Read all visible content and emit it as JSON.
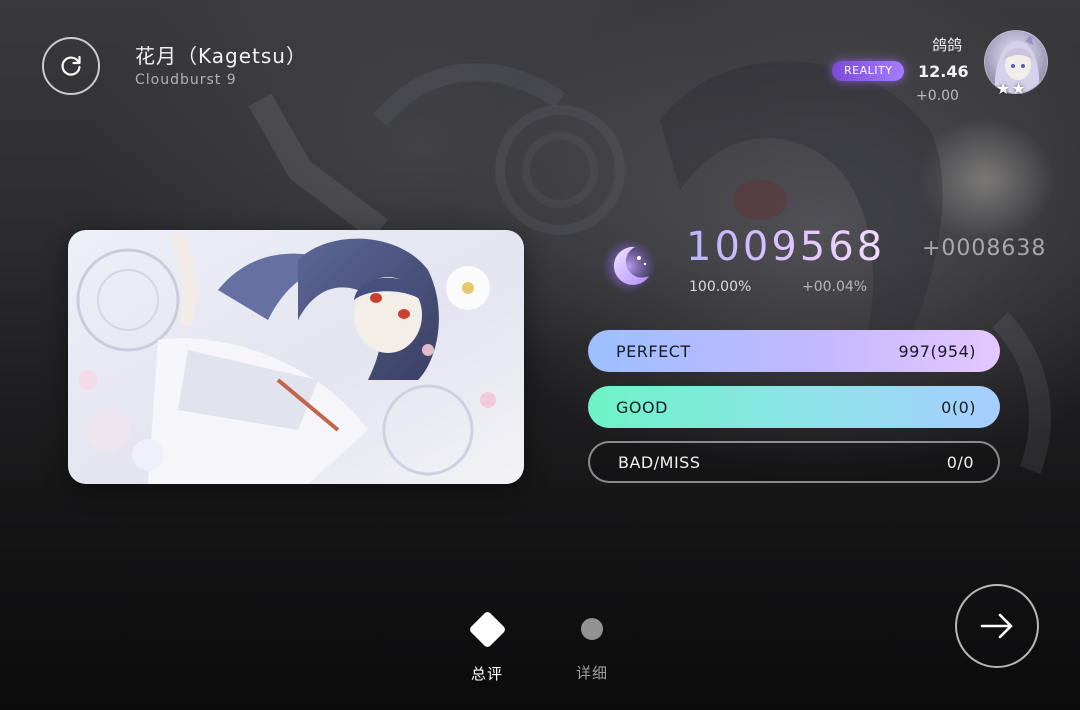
{
  "song": {
    "title": "花月（Kagetsu）",
    "level": "Cloudburst 9"
  },
  "player": {
    "name": "鸽鸽",
    "badge": "REALITY",
    "rks": "12.46",
    "rks_delta": "+0.00",
    "stars": "★★"
  },
  "result": {
    "score": "1009568",
    "score_delta": "+0008638",
    "accuracy": "100.00%",
    "accuracy_delta": "+00.04%"
  },
  "judgements": [
    {
      "label": "PERFECT",
      "value": "997(954)"
    },
    {
      "label": "GOOD",
      "value": "0(0)"
    },
    {
      "label": "BAD/MISS",
      "value": "0/0"
    }
  ],
  "tabs": {
    "summary": "总评",
    "detail": "详细"
  },
  "icons": {
    "restart": "restart-icon",
    "grade": "moon-grade-icon",
    "next": "arrow-right-icon"
  },
  "colors": {
    "perfect_start": "#9cc0ff",
    "perfect_end": "#e4c7ff",
    "good_start": "#6ef3c5",
    "good_end": "#a7cdff",
    "score_accent": "#c9b8ff",
    "badge": "#8f5ee8"
  }
}
